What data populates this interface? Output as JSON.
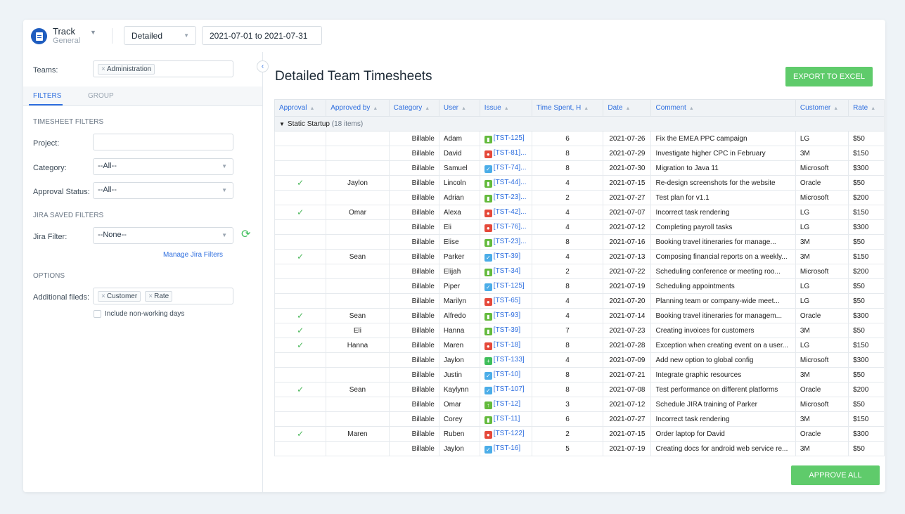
{
  "app": {
    "title": "Track",
    "subtitle": "General"
  },
  "toolbar": {
    "report_type": "Detailed",
    "date_range": "2021-07-01 to 2021-07-31"
  },
  "sidebar": {
    "teams_label": "Teams:",
    "teams_tags": [
      "Administration"
    ],
    "tabs": [
      "FILTERS",
      "GROUP"
    ],
    "timesheet_filters_header": "TIMESHEET FILTERS",
    "project_label": "Project:",
    "project_value": "",
    "category_label": "Category:",
    "category_value": "--All--",
    "approval_label": "Approval Status:",
    "approval_value": "--All--",
    "jira_header": "JIRA SAVED FILTERS",
    "jira_label": "Jira Filter:",
    "jira_value": "--None--",
    "manage_link": "Manage Jira Filters",
    "options_header": "OPTIONS",
    "additional_label": "Additional fileds:",
    "additional_tags": [
      "Customer",
      "Rate"
    ],
    "nonworking_label": "Include non-working days"
  },
  "main": {
    "title": "Detailed Team Timesheets",
    "export_label": "EXPORT TO EXCEL",
    "approve_all_label": "APPROVE ALL",
    "columns": [
      "Approval",
      "Approved by",
      "Category",
      "User",
      "Issue",
      "Time Spent, H",
      "Date",
      "Comment",
      "Customer",
      "Rate"
    ],
    "group_label": "Static Startup",
    "group_count": "(18 items)",
    "rows": [
      {
        "approved": false,
        "by": "",
        "cat": "Billable",
        "user": "Adam",
        "icon": "story",
        "issue": "[TST-125]",
        "time": "6",
        "date": "2021-07-26",
        "comment": "Fix the EMEA PPC campaign",
        "customer": "LG",
        "rate": "$50"
      },
      {
        "approved": false,
        "by": "",
        "cat": "Billable",
        "user": "David",
        "icon": "bug",
        "issue": "[TST-81]...",
        "time": "8",
        "date": "2021-07-29",
        "comment": "Investigate higher CPC in February",
        "customer": "3M",
        "rate": "$150"
      },
      {
        "approved": false,
        "by": "",
        "cat": "Billable",
        "user": "Samuel",
        "icon": "task",
        "issue": "[TST-74]...",
        "time": "8",
        "date": "2021-07-30",
        "comment": "Migration to Java 11",
        "customer": "Microsoft",
        "rate": "$300"
      },
      {
        "approved": true,
        "by": "Jaylon",
        "cat": "Billable",
        "user": "Lincoln",
        "icon": "story",
        "issue": "[TST-44]...",
        "time": "4",
        "date": "2021-07-15",
        "comment": "Re-design screenshots for the website",
        "customer": "Oracle",
        "rate": "$50"
      },
      {
        "approved": false,
        "by": "",
        "cat": "Billable",
        "user": "Adrian",
        "icon": "story",
        "issue": "[TST-23]...",
        "time": "2",
        "date": "2021-07-27",
        "comment": "Test plan for v1.1",
        "customer": "Microsoft",
        "rate": "$200"
      },
      {
        "approved": true,
        "by": "Omar",
        "cat": "Billable",
        "user": "Alexa",
        "icon": "bug",
        "issue": "[TST-42]...",
        "time": "4",
        "date": "2021-07-07",
        "comment": "Incorrect task rendering",
        "customer": "LG",
        "rate": "$150"
      },
      {
        "approved": false,
        "by": "",
        "cat": "Billable",
        "user": "Eli",
        "icon": "bug",
        "issue": "[TST-76]...",
        "time": "4",
        "date": "2021-07-12",
        "comment": "Completing payroll tasks",
        "customer": "LG",
        "rate": "$300"
      },
      {
        "approved": false,
        "by": "",
        "cat": "Billable",
        "user": "Elise",
        "icon": "story",
        "issue": "[TST-23]...",
        "time": "8",
        "date": "2021-07-16",
        "comment": "Booking travel itineraries for manage...",
        "customer": "3M",
        "rate": "$50"
      },
      {
        "approved": true,
        "by": "Sean",
        "cat": "Billable",
        "user": "Parker",
        "icon": "task",
        "issue": "[TST-39]",
        "time": "4",
        "date": "2021-07-13",
        "comment": "Composing financial reports on a weekly...",
        "customer": "3M",
        "rate": "$150"
      },
      {
        "approved": false,
        "by": "",
        "cat": "Billable",
        "user": "Elijah",
        "icon": "story",
        "issue": "[TST-34]",
        "time": "2",
        "date": "2021-07-22",
        "comment": "Scheduling conference or meeting roo...",
        "customer": "Microsoft",
        "rate": "$200"
      },
      {
        "approved": false,
        "by": "",
        "cat": "Billable",
        "user": "Piper",
        "icon": "task",
        "issue": "[TST-125]",
        "time": "8",
        "date": "2021-07-19",
        "comment": "Scheduling appointments",
        "customer": "LG",
        "rate": "$50"
      },
      {
        "approved": false,
        "by": "",
        "cat": "Billable",
        "user": "Marilyn",
        "icon": "bug",
        "issue": "[TST-65]",
        "time": "4",
        "date": "2021-07-20",
        "comment": "Planning team or company-wide meet...",
        "customer": "LG",
        "rate": "$50"
      },
      {
        "approved": true,
        "by": "Sean",
        "cat": "Billable",
        "user": "Alfredo",
        "icon": "story",
        "issue": "[TST-93]",
        "time": "4",
        "date": "2021-07-14",
        "comment": "Booking travel itineraries for managem...",
        "customer": "Oracle",
        "rate": "$300"
      },
      {
        "approved": true,
        "by": "Eli",
        "cat": "Billable",
        "user": "Hanna",
        "icon": "story",
        "issue": "[TST-39]",
        "time": "7",
        "date": "2021-07-23",
        "comment": "Creating invoices for customers",
        "customer": "3M",
        "rate": "$50"
      },
      {
        "approved": true,
        "by": "Hanna",
        "cat": "Billable",
        "user": "Maren",
        "icon": "bug",
        "issue": "[TST-18]",
        "time": "8",
        "date": "2021-07-28",
        "comment": "Exception when creating event on a user...",
        "customer": "LG",
        "rate": "$150"
      },
      {
        "approved": false,
        "by": "",
        "cat": "Billable",
        "user": "Jaylon",
        "icon": "new",
        "issue": "[TST-133]",
        "time": "4",
        "date": "2021-07-09",
        "comment": "Add new option to global config",
        "customer": "Microsoft",
        "rate": "$300"
      },
      {
        "approved": false,
        "by": "",
        "cat": "Billable",
        "user": "Justin",
        "icon": "task",
        "issue": "[TST-10]",
        "time": "8",
        "date": "2021-07-21",
        "comment": "Integrate graphic resources",
        "customer": "3M",
        "rate": "$50"
      },
      {
        "approved": true,
        "by": "Sean",
        "cat": "Billable",
        "user": "Kaylynn",
        "icon": "task",
        "issue": "[TST-107]",
        "time": "8",
        "date": "2021-07-08",
        "comment": "Test performance on different platforms",
        "customer": "Oracle",
        "rate": "$200"
      },
      {
        "approved": false,
        "by": "",
        "cat": "Billable",
        "user": "Omar",
        "icon": "improve",
        "issue": "[TST-12]",
        "time": "3",
        "date": "2021-07-12",
        "comment": "Schedule JIRA training of Parker",
        "customer": "Microsoft",
        "rate": "$50"
      },
      {
        "approved": false,
        "by": "",
        "cat": "Billable",
        "user": "Corey",
        "icon": "story",
        "issue": "[TST-11]",
        "time": "6",
        "date": "2021-07-27",
        "comment": "Incorrect task rendering",
        "customer": "3M",
        "rate": "$150"
      },
      {
        "approved": true,
        "by": "Maren",
        "cat": "Billable",
        "user": "Ruben",
        "icon": "bug",
        "issue": "[TST-122]",
        "time": "2",
        "date": "2021-07-15",
        "comment": "Order laptop for David",
        "customer": "Oracle",
        "rate": "$300"
      },
      {
        "approved": false,
        "by": "",
        "cat": "Billable",
        "user": "Jaylon",
        "icon": "task",
        "issue": "[TST-16]",
        "time": "5",
        "date": "2021-07-19",
        "comment": "Creating docs for android web service re...",
        "customer": "3M",
        "rate": "$50"
      }
    ]
  },
  "colors": {
    "accent": "#2f6fdf",
    "green": "#5fcb6b"
  }
}
